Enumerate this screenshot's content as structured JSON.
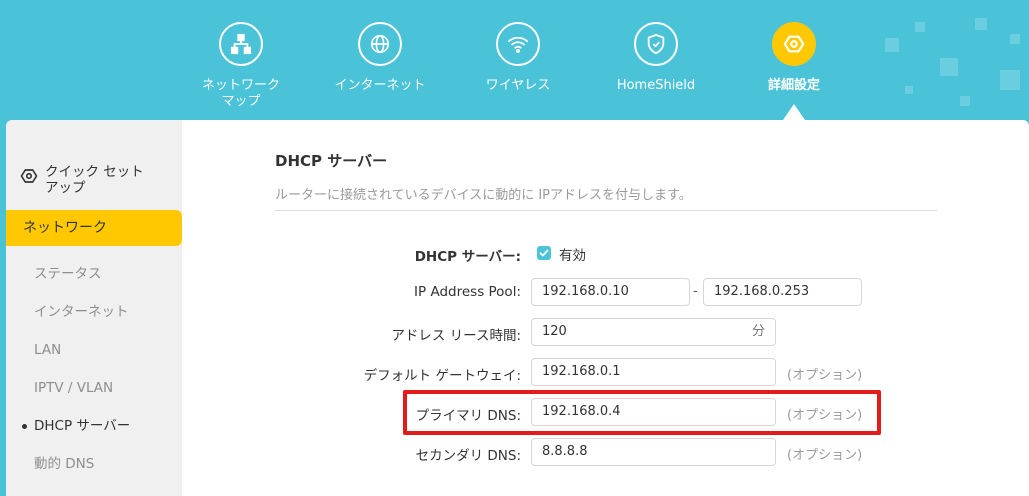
{
  "nav": {
    "items": [
      {
        "label": "ネットワーク\nマップ",
        "icon": "network-map-icon"
      },
      {
        "label": "インターネット",
        "icon": "globe-icon"
      },
      {
        "label": "ワイヤレス",
        "icon": "wifi-icon"
      },
      {
        "label": "HomeShield",
        "icon": "home-shield-icon"
      },
      {
        "label": "詳細設定",
        "icon": "gear-icon",
        "active": true
      }
    ]
  },
  "sidebar": {
    "quick_setup": "クイック セット\nアップ",
    "active_group": "ネットワーク",
    "items": [
      {
        "label": "ステータス"
      },
      {
        "label": "インターネット"
      },
      {
        "label": "LAN"
      },
      {
        "label": "IPTV / VLAN"
      },
      {
        "label": "DHCP サーバー",
        "active": true
      },
      {
        "label": "動的 DNS"
      }
    ]
  },
  "dhcp": {
    "title": "DHCP サーバー",
    "description": "ルーターに接続されているデバイスに動的に IPアドレスを付与します。",
    "enable_label": "DHCP サーバー:",
    "enable_value": "有効",
    "pool_label": "IP Address Pool:",
    "pool_start": "192.168.0.10",
    "pool_dash": "-",
    "pool_end": "192.168.0.253",
    "lease_label": "アドレス リース時間:",
    "lease_value": "120",
    "lease_unit": "分",
    "gateway_label": "デフォルト ゲートウェイ:",
    "gateway_value": "192.168.0.1",
    "primary_dns_label": "プライマリ DNS:",
    "primary_dns_value": "192.168.0.4",
    "secondary_dns_label": "セカンダリ DNS:",
    "secondary_dns_value": "8.8.8.8",
    "optional": "(オプション)"
  },
  "colors": {
    "header": "#4ac3d9",
    "accent": "#ffc800",
    "highlight": "#e41b1b"
  }
}
